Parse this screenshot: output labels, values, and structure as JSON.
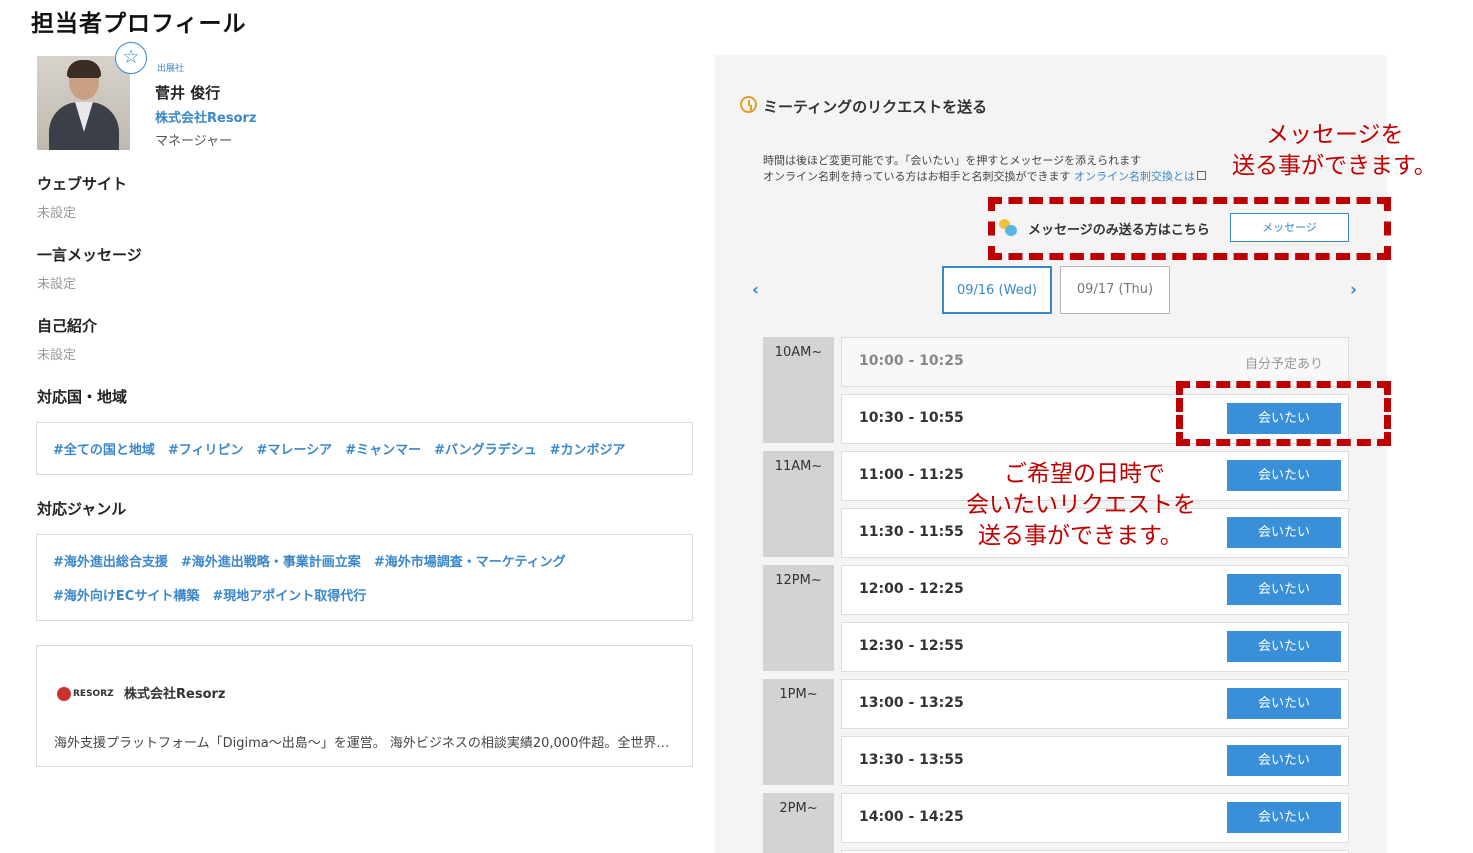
{
  "page_title": "担当者プロフィール",
  "profile": {
    "avatar_icon": "person-photo",
    "favorite_icon": "star-icon",
    "favorite_glyph": "☆",
    "badge": "出展社",
    "name": "菅井 俊行",
    "company": "株式会社Resorz",
    "role": "マネージャー"
  },
  "sections": {
    "website": {
      "label": "ウェブサイト",
      "value": "未設定"
    },
    "message": {
      "label": "一言メッセージ",
      "value": "未設定"
    },
    "intro": {
      "label": "自己紹介",
      "value": "未設定"
    },
    "regions": {
      "label": "対応国・地域",
      "tags": [
        "#全ての国と地域",
        "#フィリピン",
        "#マレーシア",
        "#ミャンマー",
        "#バングラデシュ",
        "#カンボジア"
      ]
    },
    "genres": {
      "label": "対応ジャンル",
      "tags_row1": [
        "#海外進出総合支援",
        "#海外進出戦略・事業計画立案",
        "#海外市場調査・マーケティング"
      ],
      "tags_row2": [
        "#海外向けECサイト構築",
        "#現地アポイント取得代行"
      ]
    }
  },
  "company_card": {
    "logo_text": "RESORZ",
    "name": "株式会社Resorz",
    "description": "海外支援プラットフォーム「Digima〜出島〜」を運営。 海外ビジネスの相談実績20,000件超。全世界の海外ビジネスの支援"
  },
  "meeting": {
    "title": "ミーティングのリクエストを送る",
    "note_line1": "時間は後ほど変更可能です。「会いたい」を押すとメッセージを添えられます",
    "note_line2": "オンライン名刺を持っている方はお相手と名刺交換ができます",
    "note_link": "オンライン名刺交換とは",
    "message_only_label": "メッセージのみ送る方はこちら",
    "message_button": "メッセージ",
    "prev_arrow": "‹",
    "next_arrow": "›",
    "dates": [
      "09/16 (Wed)",
      "09/17 (Thu)"
    ],
    "selected_date": "09/16 (Wed)",
    "hours": [
      "10AM~",
      "11AM~",
      "12PM~",
      "1PM~",
      "2PM~"
    ],
    "slots": [
      {
        "time": "10:00 - 10:25",
        "status": "自分予定あり"
      },
      {
        "time": "10:30 - 10:55",
        "button": "会いたい"
      },
      {
        "time": "11:00 - 11:25",
        "button": "会いたい"
      },
      {
        "time": "11:30 - 11:55",
        "button": "会いたい"
      },
      {
        "time": "12:00 - 12:25",
        "button": "会いたい"
      },
      {
        "time": "12:30 - 12:55",
        "button": "会いたい"
      },
      {
        "time": "13:00 - 13:25",
        "button": "会いたい"
      },
      {
        "time": "13:30 - 13:55",
        "button": "会いたい"
      },
      {
        "time": "14:00 - 14:25",
        "button": "会いたい"
      }
    ]
  },
  "annotations": {
    "message_line1": "メッセージを",
    "message_line2": "送る事ができます。",
    "request_line1": "ご希望の日時で",
    "request_line2": "会いたいリクエストを",
    "request_line3": "送る事ができます。",
    "color": "#c00000"
  },
  "colors": {
    "accent": "#3a87c9",
    "button": "#3a8fd9",
    "panel": "#f4f4f4"
  }
}
